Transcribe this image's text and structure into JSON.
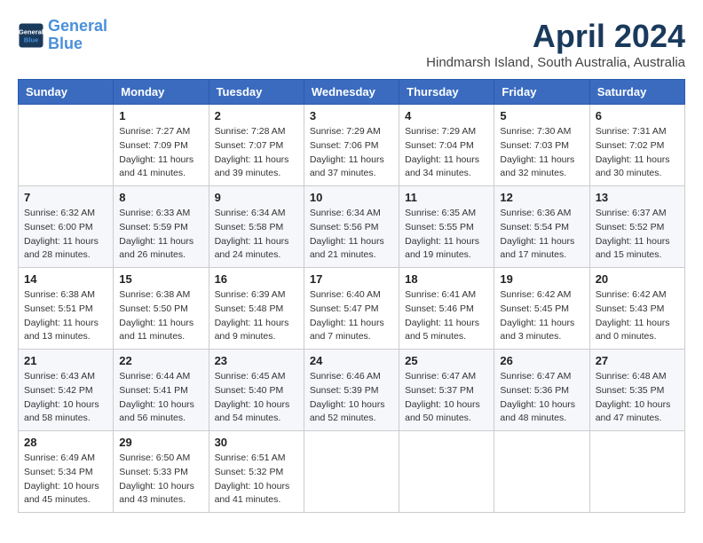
{
  "header": {
    "logo_line1": "General",
    "logo_line2": "Blue",
    "month_title": "April 2024",
    "subtitle": "Hindmarsh Island, South Australia, Australia"
  },
  "weekdays": [
    "Sunday",
    "Monday",
    "Tuesday",
    "Wednesday",
    "Thursday",
    "Friday",
    "Saturday"
  ],
  "weeks": [
    [
      {
        "day": "",
        "info": ""
      },
      {
        "day": "1",
        "info": "Sunrise: 7:27 AM\nSunset: 7:09 PM\nDaylight: 11 hours\nand 41 minutes."
      },
      {
        "day": "2",
        "info": "Sunrise: 7:28 AM\nSunset: 7:07 PM\nDaylight: 11 hours\nand 39 minutes."
      },
      {
        "day": "3",
        "info": "Sunrise: 7:29 AM\nSunset: 7:06 PM\nDaylight: 11 hours\nand 37 minutes."
      },
      {
        "day": "4",
        "info": "Sunrise: 7:29 AM\nSunset: 7:04 PM\nDaylight: 11 hours\nand 34 minutes."
      },
      {
        "day": "5",
        "info": "Sunrise: 7:30 AM\nSunset: 7:03 PM\nDaylight: 11 hours\nand 32 minutes."
      },
      {
        "day": "6",
        "info": "Sunrise: 7:31 AM\nSunset: 7:02 PM\nDaylight: 11 hours\nand 30 minutes."
      }
    ],
    [
      {
        "day": "7",
        "info": "Sunrise: 6:32 AM\nSunset: 6:00 PM\nDaylight: 11 hours\nand 28 minutes."
      },
      {
        "day": "8",
        "info": "Sunrise: 6:33 AM\nSunset: 5:59 PM\nDaylight: 11 hours\nand 26 minutes."
      },
      {
        "day": "9",
        "info": "Sunrise: 6:34 AM\nSunset: 5:58 PM\nDaylight: 11 hours\nand 24 minutes."
      },
      {
        "day": "10",
        "info": "Sunrise: 6:34 AM\nSunset: 5:56 PM\nDaylight: 11 hours\nand 21 minutes."
      },
      {
        "day": "11",
        "info": "Sunrise: 6:35 AM\nSunset: 5:55 PM\nDaylight: 11 hours\nand 19 minutes."
      },
      {
        "day": "12",
        "info": "Sunrise: 6:36 AM\nSunset: 5:54 PM\nDaylight: 11 hours\nand 17 minutes."
      },
      {
        "day": "13",
        "info": "Sunrise: 6:37 AM\nSunset: 5:52 PM\nDaylight: 11 hours\nand 15 minutes."
      }
    ],
    [
      {
        "day": "14",
        "info": "Sunrise: 6:38 AM\nSunset: 5:51 PM\nDaylight: 11 hours\nand 13 minutes."
      },
      {
        "day": "15",
        "info": "Sunrise: 6:38 AM\nSunset: 5:50 PM\nDaylight: 11 hours\nand 11 minutes."
      },
      {
        "day": "16",
        "info": "Sunrise: 6:39 AM\nSunset: 5:48 PM\nDaylight: 11 hours\nand 9 minutes."
      },
      {
        "day": "17",
        "info": "Sunrise: 6:40 AM\nSunset: 5:47 PM\nDaylight: 11 hours\nand 7 minutes."
      },
      {
        "day": "18",
        "info": "Sunrise: 6:41 AM\nSunset: 5:46 PM\nDaylight: 11 hours\nand 5 minutes."
      },
      {
        "day": "19",
        "info": "Sunrise: 6:42 AM\nSunset: 5:45 PM\nDaylight: 11 hours\nand 3 minutes."
      },
      {
        "day": "20",
        "info": "Sunrise: 6:42 AM\nSunset: 5:43 PM\nDaylight: 11 hours\nand 0 minutes."
      }
    ],
    [
      {
        "day": "21",
        "info": "Sunrise: 6:43 AM\nSunset: 5:42 PM\nDaylight: 10 hours\nand 58 minutes."
      },
      {
        "day": "22",
        "info": "Sunrise: 6:44 AM\nSunset: 5:41 PM\nDaylight: 10 hours\nand 56 minutes."
      },
      {
        "day": "23",
        "info": "Sunrise: 6:45 AM\nSunset: 5:40 PM\nDaylight: 10 hours\nand 54 minutes."
      },
      {
        "day": "24",
        "info": "Sunrise: 6:46 AM\nSunset: 5:39 PM\nDaylight: 10 hours\nand 52 minutes."
      },
      {
        "day": "25",
        "info": "Sunrise: 6:47 AM\nSunset: 5:37 PM\nDaylight: 10 hours\nand 50 minutes."
      },
      {
        "day": "26",
        "info": "Sunrise: 6:47 AM\nSunset: 5:36 PM\nDaylight: 10 hours\nand 48 minutes."
      },
      {
        "day": "27",
        "info": "Sunrise: 6:48 AM\nSunset: 5:35 PM\nDaylight: 10 hours\nand 47 minutes."
      }
    ],
    [
      {
        "day": "28",
        "info": "Sunrise: 6:49 AM\nSunset: 5:34 PM\nDaylight: 10 hours\nand 45 minutes."
      },
      {
        "day": "29",
        "info": "Sunrise: 6:50 AM\nSunset: 5:33 PM\nDaylight: 10 hours\nand 43 minutes."
      },
      {
        "day": "30",
        "info": "Sunrise: 6:51 AM\nSunset: 5:32 PM\nDaylight: 10 hours\nand 41 minutes."
      },
      {
        "day": "",
        "info": ""
      },
      {
        "day": "",
        "info": ""
      },
      {
        "day": "",
        "info": ""
      },
      {
        "day": "",
        "info": ""
      }
    ]
  ]
}
